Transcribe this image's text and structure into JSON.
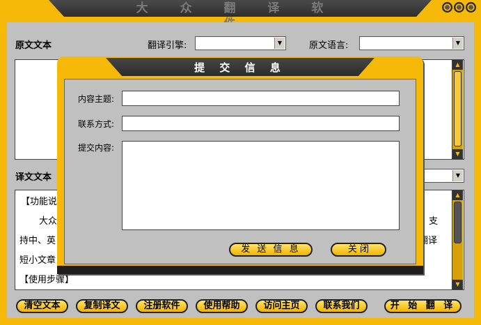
{
  "window": {
    "title": "大 众 翻 译 软 件"
  },
  "source": {
    "label": "原文文本",
    "engine_label": "翻译引擎:",
    "engine_value": "",
    "lang_label": "原文语言:",
    "lang_value": ""
  },
  "target": {
    "label": "译文文本",
    "lang_value": "",
    "lines": [
      "【功能说",
      "大众",
      "支",
      "持中、英",
      "翻译",
      "短小文章",
      "【使用步骤】"
    ]
  },
  "dialog": {
    "title": "提 交 信 息",
    "subject_label": "内容主题:",
    "subject_value": "",
    "contact_label": "联系方式:",
    "contact_value": "",
    "content_label": "提交内容:",
    "content_value": "",
    "send_label": "发 送 信 息",
    "close_label": "关  闭"
  },
  "buttons": {
    "clear": "清空文本",
    "copy": "复制译文",
    "register": "注册软件",
    "help": "使用帮助",
    "home": "访问主页",
    "contact": "联系我们",
    "translate": "开 始 翻 译"
  },
  "colors": {
    "frame": "#f7b908",
    "title_bar": "#3a3a3a",
    "panel": "#c0c0c0"
  }
}
